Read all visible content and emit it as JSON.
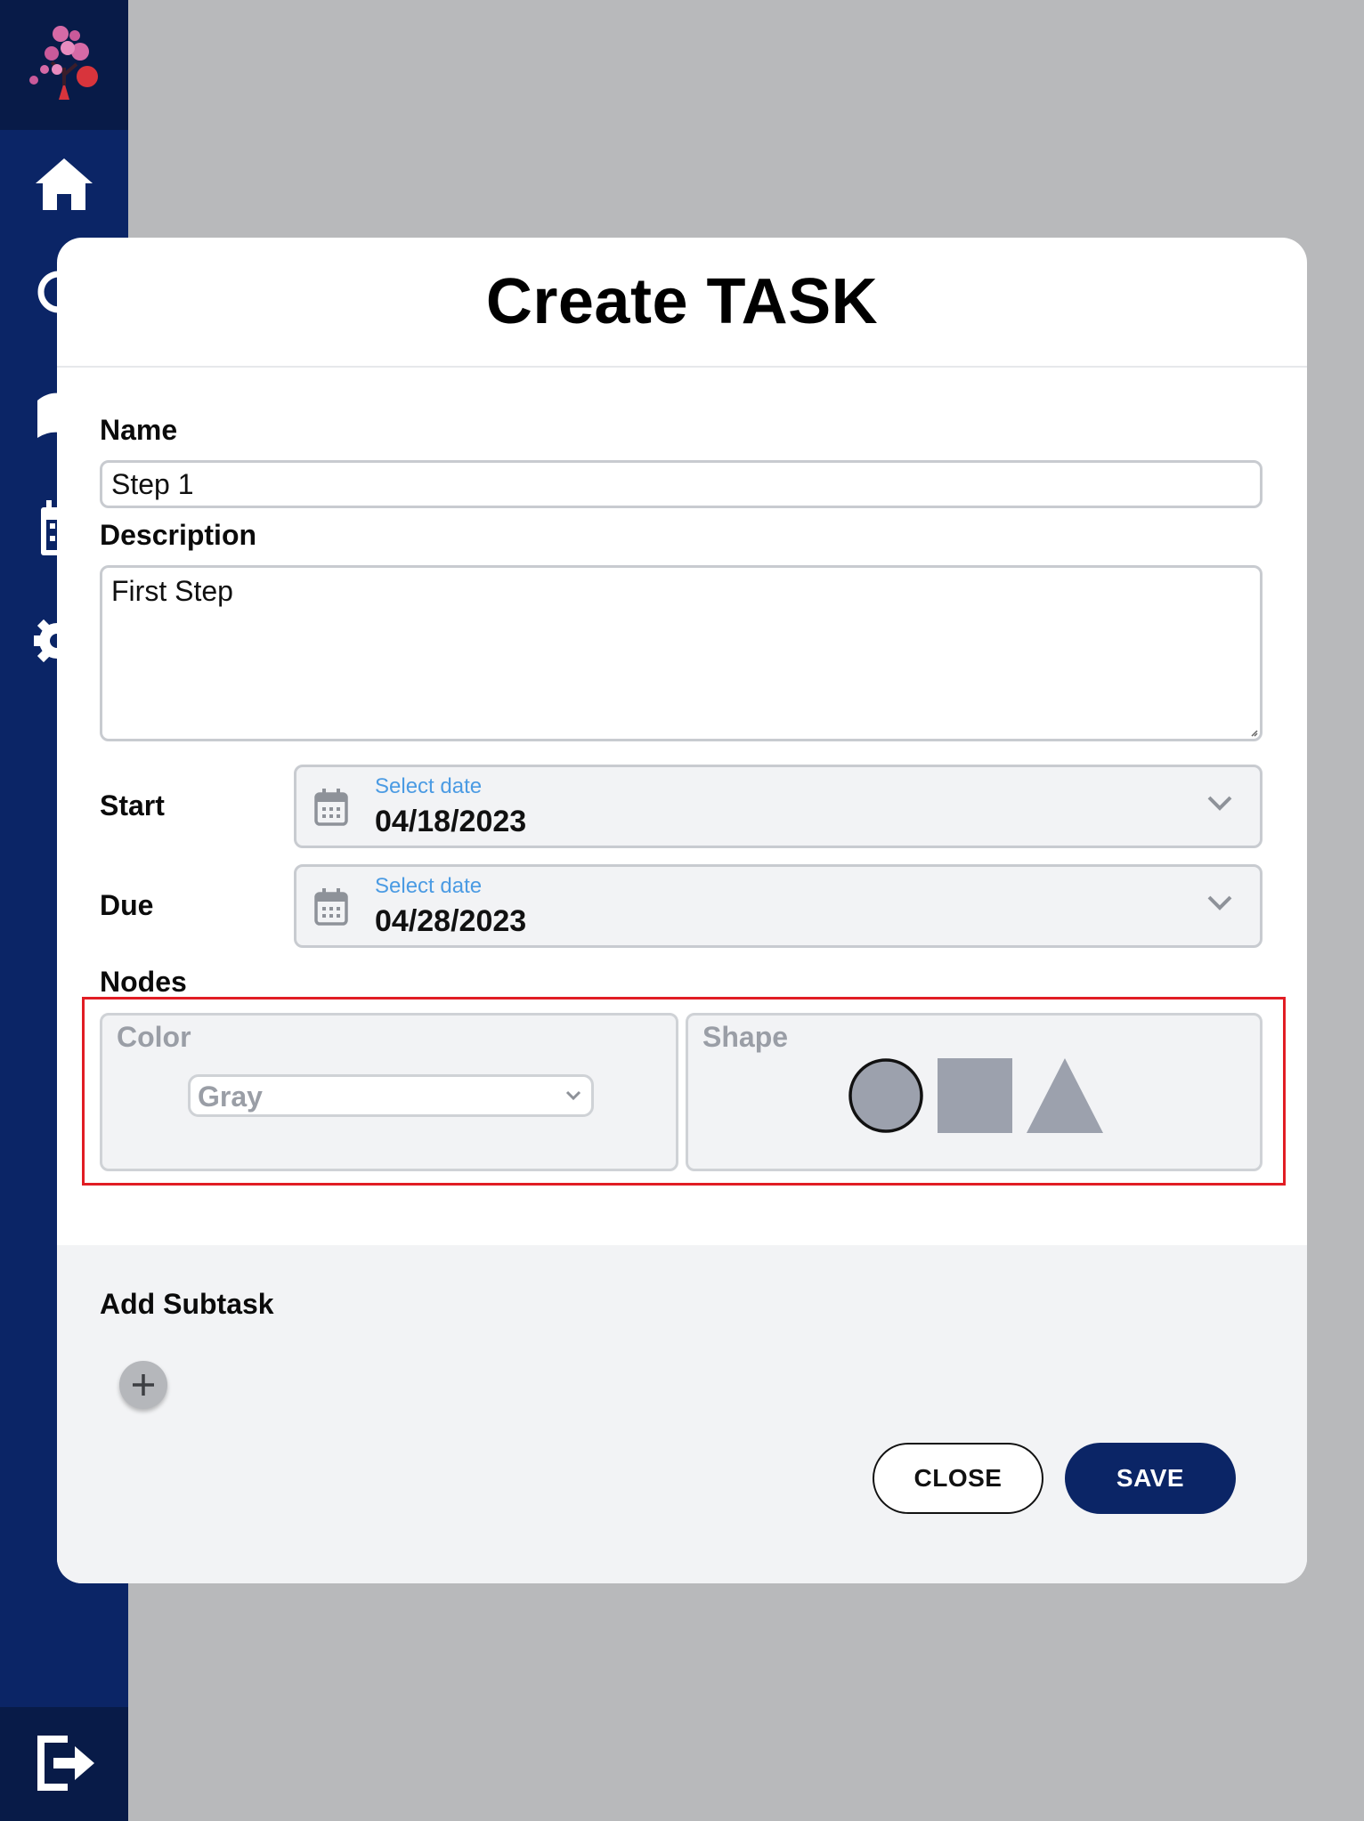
{
  "modal": {
    "title": "Create TASK",
    "name": {
      "label": "Name",
      "value": "Step 1"
    },
    "description": {
      "label": "Description",
      "value": "First Step"
    },
    "start": {
      "label": "Start",
      "hint": "Select date",
      "value": "04/18/2023"
    },
    "due": {
      "label": "Due",
      "hint": "Select date",
      "value": "04/28/2023"
    },
    "nodes": {
      "label": "Nodes",
      "color": {
        "title": "Color",
        "selected": "Gray"
      },
      "shape": {
        "title": "Shape",
        "options": [
          "circle",
          "square",
          "triangle"
        ],
        "selected": "circle"
      }
    },
    "subtask": {
      "label": "Add Subtask"
    },
    "buttons": {
      "close": "CLOSE",
      "save": "SAVE"
    }
  },
  "sidebar": {
    "icons": [
      "app-logo-icon",
      "home-icon",
      "search-icon",
      "book-icon",
      "calendar-icon",
      "gear-icon",
      "logout-icon"
    ]
  },
  "colors": {
    "sidebar": "#0b2566",
    "sidebar_dark": "#081b48",
    "accent": "#0b2566",
    "hint": "#4b9be3",
    "highlight": "#e11d24",
    "node_gray": "#9ca1ad"
  }
}
